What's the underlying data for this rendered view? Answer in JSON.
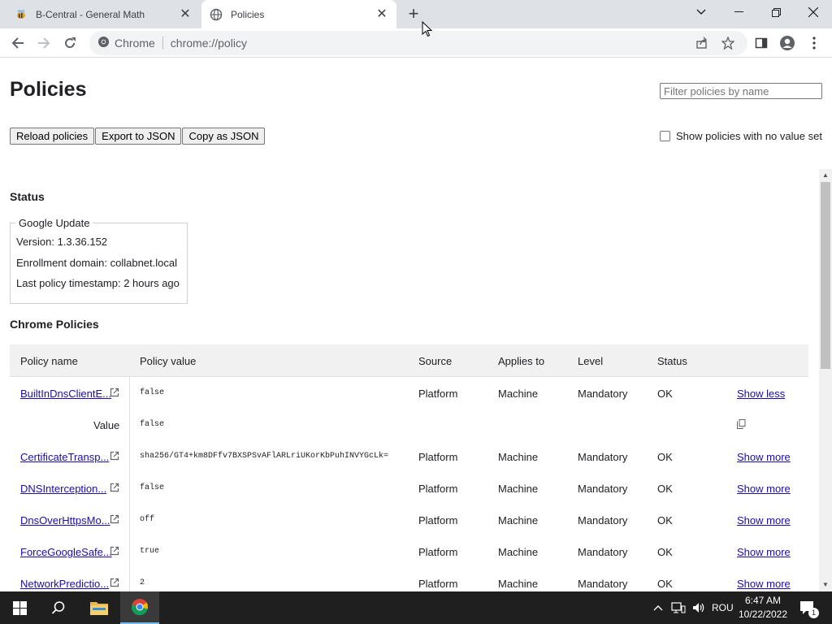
{
  "browser": {
    "tabs": [
      {
        "title": "B-Central - General Math",
        "icon": "bee-favicon"
      },
      {
        "title": "Policies",
        "icon": "globe-favicon"
      }
    ],
    "omnibox": {
      "site_label": "Chrome",
      "url": "chrome://policy"
    }
  },
  "page": {
    "title": "Policies",
    "filter_placeholder": "Filter policies by name",
    "buttons": {
      "reload": "Reload policies",
      "export": "Export to JSON",
      "copy": "Copy as JSON"
    },
    "show_no_value_label": "Show policies with no value set",
    "status": {
      "heading": "Status",
      "group": "Google Update",
      "version": "Version: 1.3.36.152",
      "enrollment": "Enrollment domain: collabnet.local",
      "timestamp": "Last policy timestamp: 2 hours ago"
    },
    "chrome_policies": {
      "heading": "Chrome Policies",
      "columns": [
        "Policy name",
        "Policy value",
        "Source",
        "Applies to",
        "Level",
        "Status"
      ],
      "rows": [
        {
          "name": "BuiltInDnsClientE...",
          "value": "false",
          "source": "Platform",
          "applies": "Machine",
          "level": "Mandatory",
          "status": "OK",
          "action": "Show less"
        },
        {
          "name": "CertificateTransp...",
          "value": "sha256/GT4+km8DFfv7BXSPSvAFlARLriUKorKbPuhINVYGcLk=",
          "source": "Platform",
          "applies": "Machine",
          "level": "Mandatory",
          "status": "OK",
          "action": "Show more"
        },
        {
          "name": "DNSInterception...",
          "value": "false",
          "source": "Platform",
          "applies": "Machine",
          "level": "Mandatory",
          "status": "OK",
          "action": "Show more"
        },
        {
          "name": "DnsOverHttpsMo...",
          "value": "off",
          "source": "Platform",
          "applies": "Machine",
          "level": "Mandatory",
          "status": "OK",
          "action": "Show more"
        },
        {
          "name": "ForceGoogleSafe...",
          "value": "true",
          "source": "Platform",
          "applies": "Machine",
          "level": "Mandatory",
          "status": "OK",
          "action": "Show more"
        },
        {
          "name": "NetworkPredictio...",
          "value": "2",
          "source": "Platform",
          "applies": "Machine",
          "level": "Mandatory",
          "status": "OK",
          "action": "Show more"
        }
      ],
      "expanded": {
        "label": "Value",
        "value": "false"
      }
    }
  },
  "taskbar": {
    "language": "ROU",
    "time": "6:47 AM",
    "date": "10/22/2022",
    "notifications": "1"
  },
  "colors": {
    "link": "#1a0dab",
    "tabstrip": "#dee1e6",
    "taskbar": "#1f1f1f"
  }
}
